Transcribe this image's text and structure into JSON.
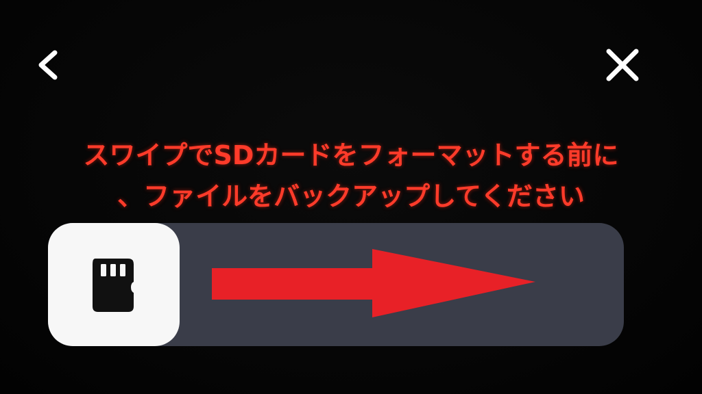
{
  "header": {
    "back_icon": "chevron-left-icon",
    "close_icon": "close-icon"
  },
  "message": {
    "line1": "スワイプでSDカードをフォーマットする前に",
    "line2": "、ファイルをバックアップしてください"
  },
  "slider": {
    "knob_icon": "sd-card-icon",
    "progress": 0,
    "track_color": "#3a3d49",
    "knob_color": "#f7f7f7"
  },
  "overlay": {
    "arrow_icon": "arrow-right-icon",
    "arrow_color": "#e82127"
  },
  "colors": {
    "warning_text": "#ff3b2a",
    "background": "#050505"
  }
}
